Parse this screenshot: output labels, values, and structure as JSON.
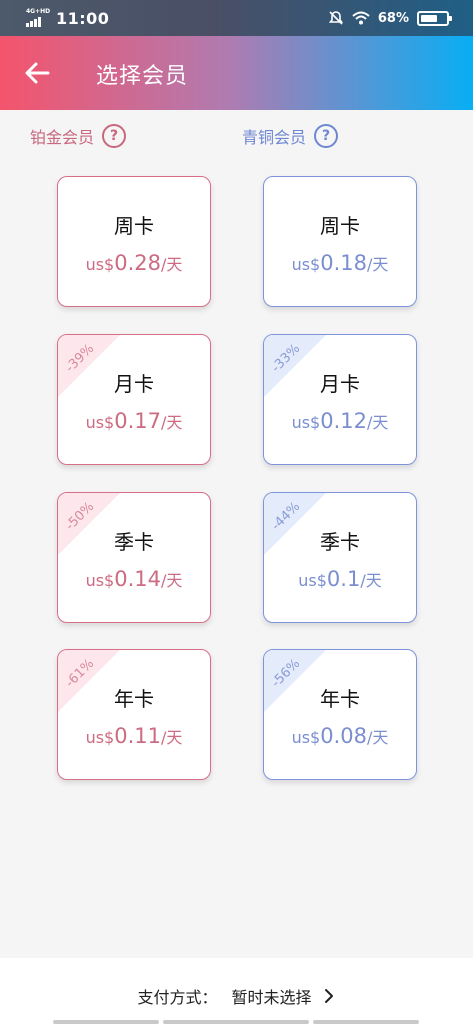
{
  "status_bar": {
    "network": "4G+HD",
    "time": "11:00",
    "battery": "68%",
    "battery_level": 0.68,
    "icons": [
      "mute-icon",
      "wifi-icon",
      "battery-icon"
    ]
  },
  "header": {
    "title": "选择会员",
    "back_icon": "arrow-left-icon"
  },
  "tiers": {
    "gold": {
      "label": "铂金会员",
      "help": "?"
    },
    "bronze": {
      "label": "青铜会员",
      "help": "?"
    }
  },
  "plans": {
    "gold": [
      {
        "name": "周卡",
        "currency": "us$",
        "amount": "0.28",
        "unit": "/天",
        "discount": ""
      },
      {
        "name": "月卡",
        "currency": "us$",
        "amount": "0.17",
        "unit": "/天",
        "discount": "-39%"
      },
      {
        "name": "季卡",
        "currency": "us$",
        "amount": "0.14",
        "unit": "/天",
        "discount": "-50%"
      },
      {
        "name": "年卡",
        "currency": "us$",
        "amount": "0.11",
        "unit": "/天",
        "discount": "-61%"
      }
    ],
    "bronze": [
      {
        "name": "周卡",
        "currency": "us$",
        "amount": "0.18",
        "unit": "/天",
        "discount": ""
      },
      {
        "name": "月卡",
        "currency": "us$",
        "amount": "0.12",
        "unit": "/天",
        "discount": "-33%"
      },
      {
        "name": "季卡",
        "currency": "us$",
        "amount": "0.1",
        "unit": "/天",
        "discount": "-44%"
      },
      {
        "name": "年卡",
        "currency": "us$",
        "amount": "0.08",
        "unit": "/天",
        "discount": "-56%"
      }
    ]
  },
  "payment": {
    "label": "支付方式：",
    "value": "暂时未选择"
  },
  "colors": {
    "gold_accent": "#d86f88",
    "bronze_accent": "#7e95dc",
    "header_start": "#f4546c",
    "header_end": "#08aef4"
  }
}
